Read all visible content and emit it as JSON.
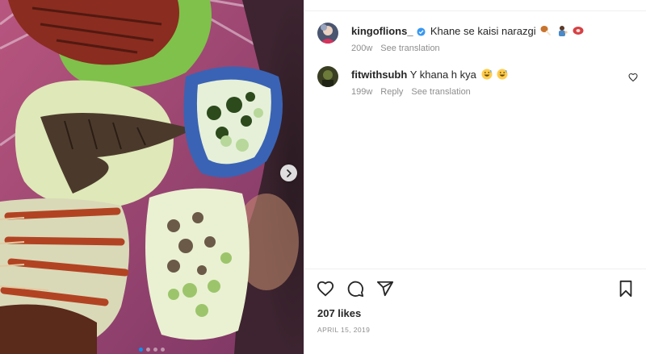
{
  "media": {
    "image_icon": "food-photo",
    "next_icon": "chevron-right-icon",
    "carousel_count": 4,
    "carousel_active_index": 0
  },
  "post": {
    "author": {
      "username": "kingoflions_",
      "verified": true,
      "caption": "Khane se kaisi narazgi",
      "caption_emojis": [
        "poultry-leg-icon",
        "person-tipping-hand-icon",
        "meat-icon"
      ],
      "age": "200w",
      "see_translation": "See translation"
    },
    "comments": [
      {
        "username": "fitwithsubh",
        "text": "Y khana h kya",
        "emojis": [
          "grinning-sweat-icon",
          "grinning-sweat-icon"
        ],
        "age": "199w",
        "reply": "Reply",
        "see_translation": "See translation"
      }
    ],
    "likes": "207 likes",
    "date": "APRIL 15, 2019"
  },
  "colors": {
    "verified": "#3897f0",
    "text": "#262626",
    "meta": "#8e8e8e",
    "accent": "#0095f6"
  }
}
